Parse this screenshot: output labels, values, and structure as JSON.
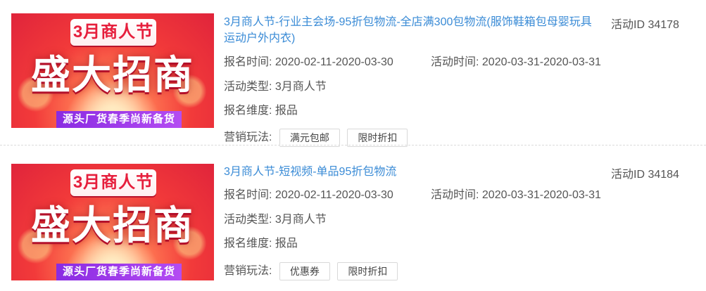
{
  "items": [
    {
      "banner": {
        "tag": "3月商人节",
        "headline": "盛大招商",
        "strip": "源头厂货春季尚新备货"
      },
      "title": "3月商人节-行业主会场-95折包物流-全店满300包物流(服饰鞋箱包母婴玩具运动户外内衣)",
      "activity_id": "活动ID 34178",
      "reg_label": "报名时间:",
      "reg_value": "2020-02-11-2020-03-30",
      "act_label": "活动时间:",
      "act_value": "2020-03-31-2020-03-31",
      "type_label": "活动类型:",
      "type_value": "3月商人节",
      "dim_label": "报名维度:",
      "dim_value": "报品",
      "mkt_label": "营销玩法:",
      "mkt_tags": [
        "满元包邮",
        "限时折扣"
      ]
    },
    {
      "banner": {
        "tag": "3月商人节",
        "headline": "盛大招商",
        "strip": "源头厂货春季尚新备货"
      },
      "title": "3月商人节-短视频-单品95折包物流",
      "activity_id": "活动ID 34184",
      "reg_label": "报名时间:",
      "reg_value": "2020-02-11-2020-03-30",
      "act_label": "活动时间:",
      "act_value": "2020-03-31-2020-03-31",
      "type_label": "活动类型:",
      "type_value": "3月商人节",
      "dim_label": "报名维度:",
      "dim_value": "报品",
      "mkt_label": "营销玩法:",
      "mkt_tags": [
        "优惠券",
        "限时折扣"
      ]
    }
  ],
  "colors": {
    "title_link": "#3a8bd6",
    "banner_red": "#e0243b",
    "strip_purple": "#8a2be2"
  }
}
